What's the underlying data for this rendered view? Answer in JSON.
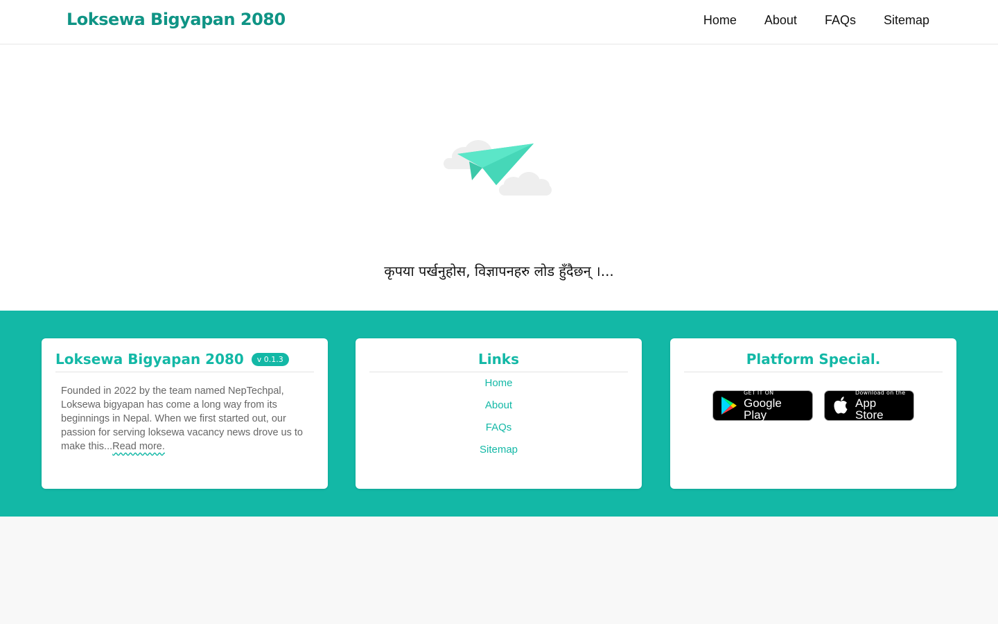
{
  "header": {
    "brand": "Loksewa Bigyapan 2080",
    "nav": [
      "Home",
      "About",
      "FAQs",
      "Sitemap"
    ]
  },
  "main": {
    "loading_illustration": "paper-plane-icon",
    "loading_text": "कृपया पर्खनुहोस, विज्ञापनहरु लोड हुँदैछन् ।..."
  },
  "footer": {
    "about_card": {
      "title": "Loksewa Bigyapan 2080",
      "version": "v 0.1.3",
      "text": "Founded in 2022 by the team named NepTechpal, Loksewa bigyapan has come a long way from its beginnings in Nepal. When we first started out, our passion for serving loksewa vacancy news drove us to make this...",
      "read_more": "Read more."
    },
    "links_card": {
      "title": "Links",
      "links": [
        "Home",
        "About",
        "FAQs",
        "Sitemap"
      ]
    },
    "platform_card": {
      "title": "Platform Special.",
      "google_play": {
        "small": "GET IT ON",
        "big": "Google Play"
      },
      "app_store": {
        "small": "Download on the",
        "big": "App Store"
      }
    }
  },
  "colors": {
    "brand": "#0f9485",
    "accent": "#13b8a6",
    "page_bg": "#f8f8f8",
    "plane": "#4fe0c0"
  }
}
